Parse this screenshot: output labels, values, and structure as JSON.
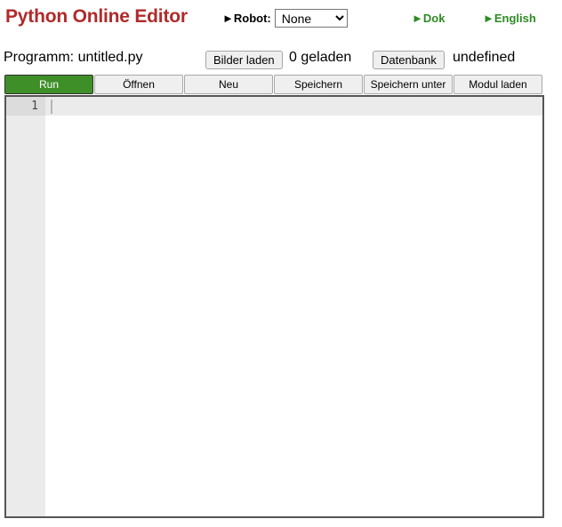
{
  "header": {
    "app_title": "Python Online Editor",
    "title_color": "#b02a2a",
    "robot_label": "►Robot:",
    "robot_select_value": "None",
    "robot_options": [
      "None"
    ],
    "links": [
      {
        "label": "►Dok",
        "name": "dok"
      },
      {
        "label": "►English",
        "name": "english"
      }
    ],
    "link_color": "#2e8b22"
  },
  "toolbar": {
    "program_label": "Programm: untitled.py",
    "load_images_button": "Bilder laden",
    "loaded_count_text": "0 geladen",
    "database_button": "Datenbank",
    "database_status": "undefined"
  },
  "tabs": [
    {
      "label": "Run",
      "active": true
    },
    {
      "label": "Öffnen",
      "active": false
    },
    {
      "label": "Neu",
      "active": false
    },
    {
      "label": "Speichern",
      "active": false
    },
    {
      "label": "Speichern unter",
      "active": false
    },
    {
      "label": "Modul laden",
      "active": false
    }
  ],
  "tab_active_color": "#3f8f29",
  "editor": {
    "line_numbers": [
      "1"
    ],
    "lines": [
      ""
    ],
    "cursor_line": 1,
    "cursor_column": 1
  }
}
